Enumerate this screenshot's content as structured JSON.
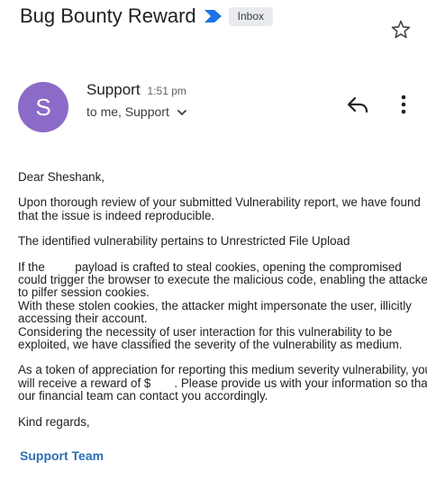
{
  "email": {
    "subject": "Bug Bounty Reward",
    "label": "Inbox",
    "sender": {
      "initial": "S",
      "name": "Support",
      "time": "1:51 pm",
      "recipients": "to me, Support"
    },
    "body": {
      "greeting": "Dear Sheshank,",
      "para1": [
        "Upon thorough review of your submitted Vulnerability report, we have found",
        "that the issue is indeed reproducible."
      ],
      "para2": "The identified vulnerability pertains to Unrestricted File Upload",
      "para3": [
        "If the         payload is crafted to steal cookies, opening the compromised",
        "could trigger the browser to execute the malicious code, enabling the attacker",
        "to pilfer session cookies.",
        "With these stolen cookies, the attacker might impersonate the user, illicitly",
        "accessing their account.",
        "Considering the necessity of user interaction for this vulnerability to be",
        "exploited, we have classified the severity of the vulnerability as medium."
      ],
      "para4": [
        "As a token of appreciation for reporting this medium severity vulnerability, you",
        "will receive a reward of $       . Please provide us with your information so that",
        "our financial team can contact you accordingly."
      ],
      "closing": "Kind regards,",
      "signature": "Support Team"
    }
  },
  "icons": {
    "label_arrow": "label-arrow-icon",
    "star": "star-outline-icon",
    "reply": "reply-icon",
    "more": "more-vert-icon",
    "chevron": "chevron-down-icon"
  },
  "colors": {
    "avatar": "#8b6bc7",
    "label_arrow": "#1a73e8",
    "chip_bg": "#e8eaed",
    "signature": "#2a6fb5"
  }
}
